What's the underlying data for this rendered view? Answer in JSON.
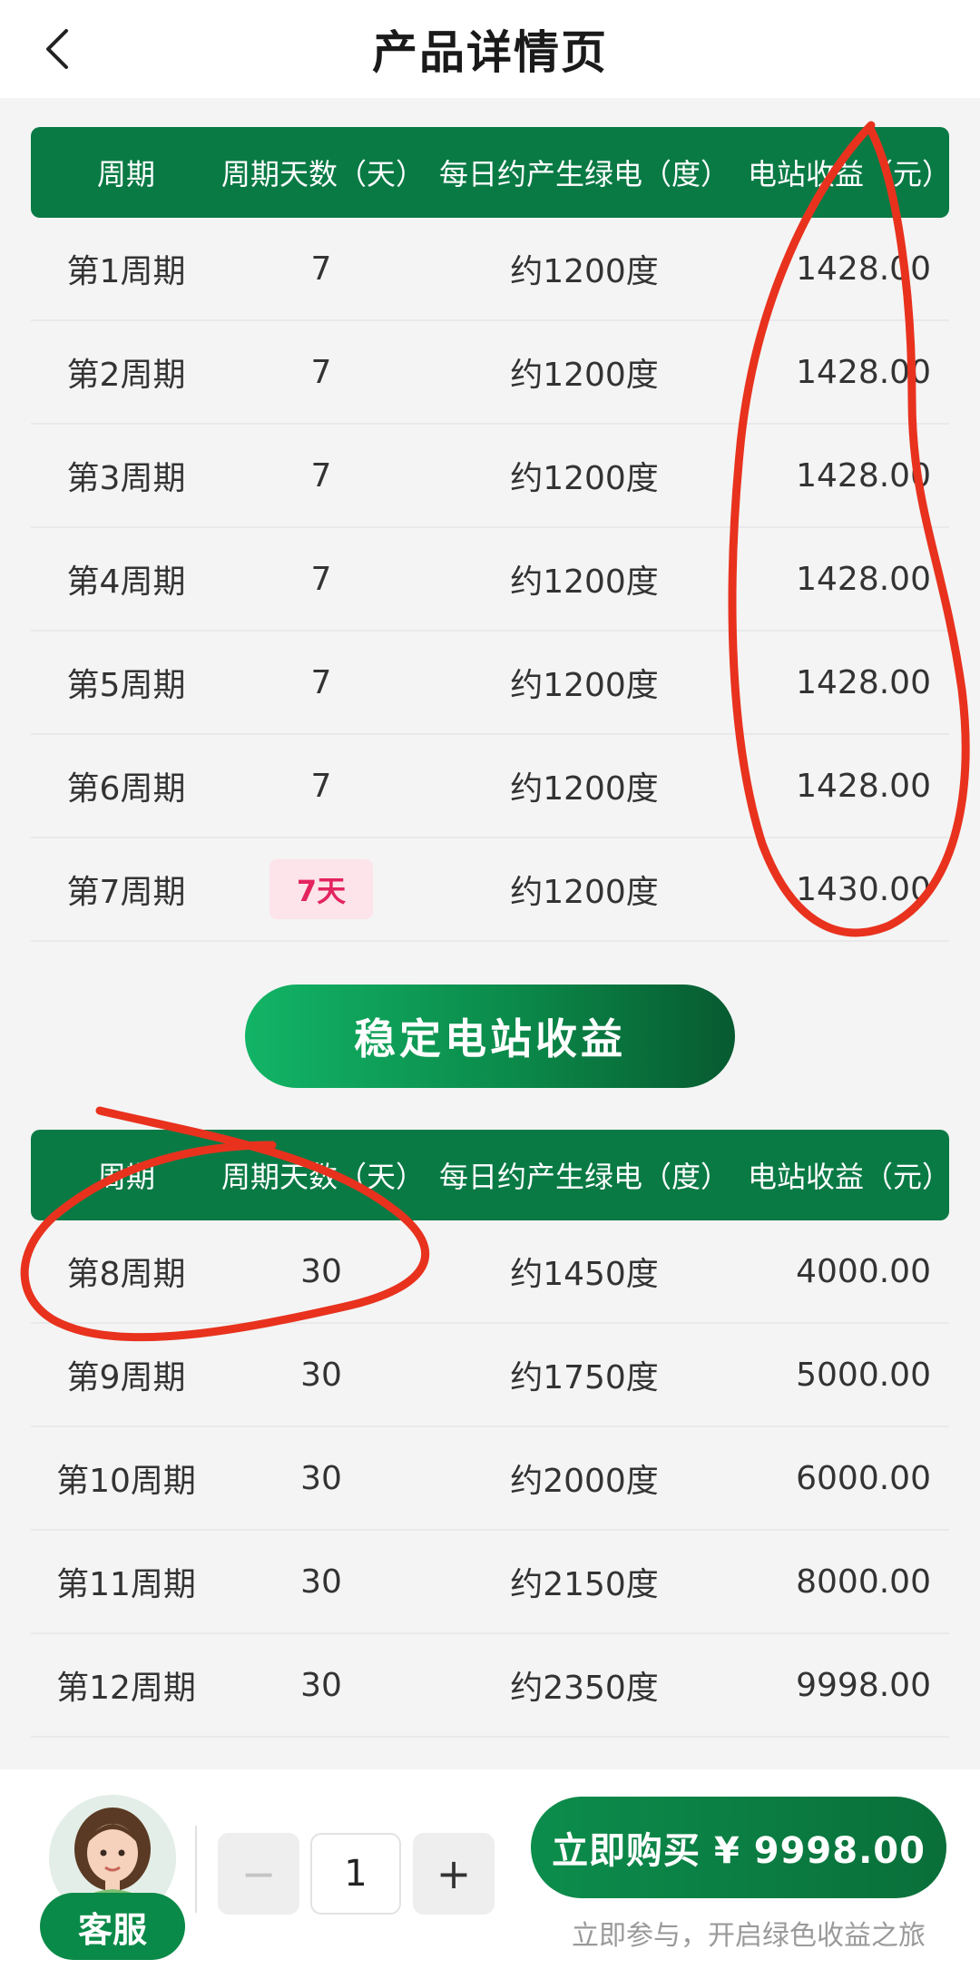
{
  "header": {
    "title": "产品详情页"
  },
  "table1": {
    "headers": [
      "周期",
      "周期天数（天）",
      "每日约产生绿电（度）",
      "电站收益（元）"
    ],
    "rows": [
      {
        "cycle": "第1周期",
        "days": "7",
        "power": "约1200度",
        "income": "1428.00"
      },
      {
        "cycle": "第2周期",
        "days": "7",
        "power": "约1200度",
        "income": "1428.00"
      },
      {
        "cycle": "第3周期",
        "days": "7",
        "power": "约1200度",
        "income": "1428.00"
      },
      {
        "cycle": "第4周期",
        "days": "7",
        "power": "约1200度",
        "income": "1428.00"
      },
      {
        "cycle": "第5周期",
        "days": "7",
        "power": "约1200度",
        "income": "1428.00"
      },
      {
        "cycle": "第6周期",
        "days": "7",
        "power": "约1200度",
        "income": "1428.00"
      },
      {
        "cycle": "第7周期",
        "days": "7天",
        "power": "约1200度",
        "income": "1430.00"
      }
    ]
  },
  "stable_button": {
    "label": "稳定电站收益"
  },
  "table2": {
    "headers": [
      "周期",
      "周期天数（天）",
      "每日约产生绿电（度）",
      "电站收益（元）"
    ],
    "rows": [
      {
        "cycle": "第8周期",
        "days": "30",
        "power": "约1450度",
        "income": "4000.00"
      },
      {
        "cycle": "第9周期",
        "days": "30",
        "power": "约1750度",
        "income": "5000.00"
      },
      {
        "cycle": "第10周期",
        "days": "30",
        "power": "约2000度",
        "income": "6000.00"
      },
      {
        "cycle": "第11周期",
        "days": "30",
        "power": "约2150度",
        "income": "8000.00"
      },
      {
        "cycle": "第12周期",
        "days": "30",
        "power": "约2350度",
        "income": "9998.00"
      }
    ]
  },
  "bottom_bar": {
    "service_label": "客服",
    "quantity_minus": "−",
    "quantity_value": "1",
    "quantity_plus": "+",
    "buy_label": "立即购买 ¥ 9998.00",
    "watermark": "立即参与，开启绿色收益之旅"
  },
  "colors": {
    "primary_green": "#0a7a45",
    "badge_bg": "#fde3ea",
    "badge_text": "#e3245f",
    "annotation_red": "#e8321e"
  }
}
